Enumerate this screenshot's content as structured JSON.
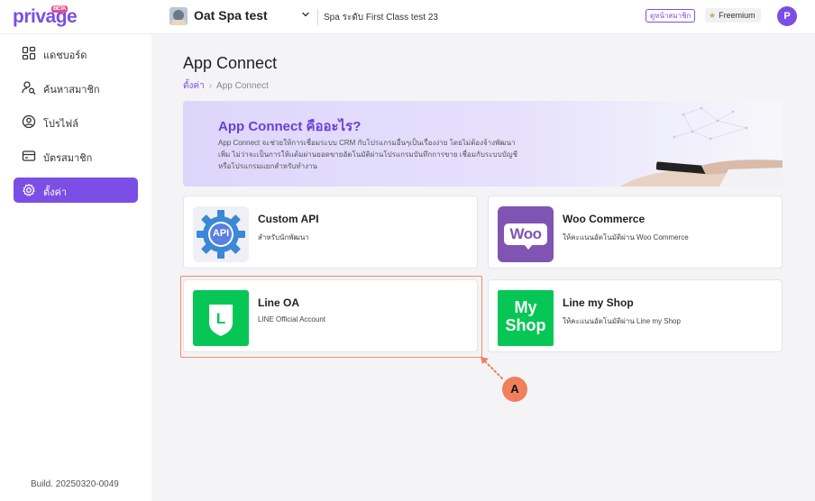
{
  "header": {
    "logo_text": "privage",
    "logo_badge": "BETA",
    "store_name": "Oat Spa test",
    "branch_name": "Spa ระดับ First Class test 23",
    "member_view_label": "ดูหน้าสมาชิก",
    "plan_label": "Freemium",
    "user_initial": "P"
  },
  "sidebar": {
    "items": [
      {
        "label": "แดชบอร์ด",
        "icon": "dashboard-icon",
        "active": false
      },
      {
        "label": "ค้นหาสมาชิก",
        "icon": "search-member-icon",
        "active": false
      },
      {
        "label": "โปรไฟล์",
        "icon": "profile-icon",
        "active": false
      },
      {
        "label": "บัตรสมาชิก",
        "icon": "member-card-icon",
        "active": false
      },
      {
        "label": "ตั้งค่า",
        "icon": "gear-icon",
        "active": true
      }
    ],
    "build": "Build. 20250320-0049"
  },
  "main": {
    "title": "App Connect",
    "breadcrumb": [
      "ตั้งค่า",
      "App Connect"
    ],
    "banner": {
      "title": "App Connect คืออะไร?",
      "description": "App Connect จะช่วยให้การเชื่อมระบบ CRM กับโปรแกรมอื่นๆเป็นเรื่องง่าย โดยไม่ต้องจ้างพัฒนาเพิ่ม ไม่ว่าจะเป็นการให้แต้มผ่านยอดขายอัตโนมัติผ่านโปรแกรมบันทึกการขาย เชื่อมกับระบบบัญชีหรือโปรแกรมแยกสำหรับทำงาน"
    },
    "cards": [
      {
        "title": "Custom API",
        "subtitle": "สำหรับนักพัฒนา",
        "logo_text": "API",
        "logo": "custom-api-logo"
      },
      {
        "title": "Woo Commerce",
        "subtitle": "ให้คะแนนอัตโนมัติผ่าน Woo Commerce",
        "logo_text": "Woo",
        "logo": "woocommerce-logo"
      },
      {
        "title": "Line OA",
        "subtitle": "LINE Official Account",
        "logo_text": "L",
        "logo": "line-logo"
      },
      {
        "title": "Line my Shop",
        "subtitle": "ให้คะแนนอัตโนมัติผ่าน Line my Shop",
        "logo_text_1": "My",
        "logo_text_2": "Shop",
        "logo": "myshop-logo"
      }
    ],
    "callout_label": "A"
  },
  "colors": {
    "accent": "#7b4ee6",
    "callout": "#f07f5c",
    "line_green": "#06c755",
    "woo_purple": "#7f54b3"
  }
}
